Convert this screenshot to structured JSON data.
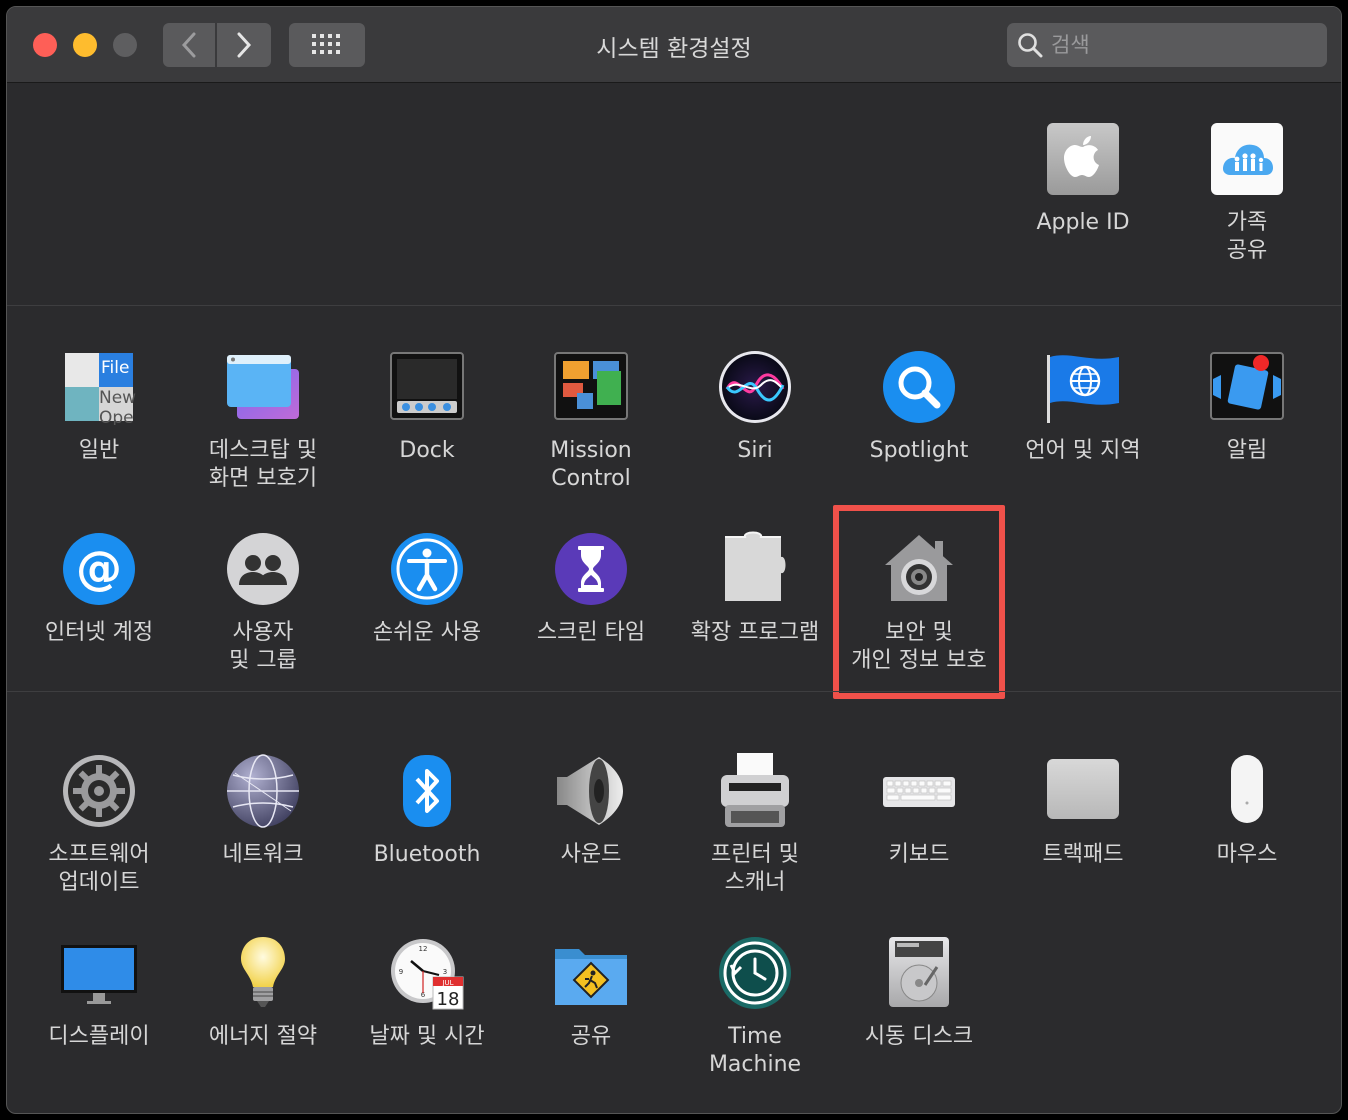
{
  "window": {
    "title": "시스템 환경설정",
    "search": {
      "placeholder": "검색",
      "value": ""
    }
  },
  "top_panes": [
    {
      "id": "apple-id",
      "label": "Apple ID",
      "icon": "apple-icon"
    },
    {
      "id": "family-sharing",
      "label": "가족\n공유",
      "icon": "family-icon"
    }
  ],
  "personal_panes": [
    {
      "id": "general",
      "label": "일반",
      "icon": "general-icon"
    },
    {
      "id": "desktop-screensaver",
      "label": "데스크탑 및\n화면 보호기",
      "icon": "desktop-icon"
    },
    {
      "id": "dock",
      "label": "Dock",
      "icon": "dock-icon"
    },
    {
      "id": "mission-control",
      "label": "Mission\nControl",
      "icon": "mission-control-icon"
    },
    {
      "id": "siri",
      "label": "Siri",
      "icon": "siri-icon"
    },
    {
      "id": "spotlight",
      "label": "Spotlight",
      "icon": "spotlight-icon"
    },
    {
      "id": "language-region",
      "label": "언어 및 지역",
      "icon": "flag-globe-icon"
    },
    {
      "id": "notifications",
      "label": "알림",
      "icon": "notifications-icon"
    },
    {
      "id": "internet-accounts",
      "label": "인터넷 계정",
      "icon": "at-icon"
    },
    {
      "id": "users-groups",
      "label": "사용자\n및 그룹",
      "icon": "users-icon"
    },
    {
      "id": "accessibility",
      "label": "손쉬운 사용",
      "icon": "accessibility-icon"
    },
    {
      "id": "screen-time",
      "label": "스크린 타임",
      "icon": "hourglass-icon"
    },
    {
      "id": "extensions",
      "label": "확장 프로그램",
      "icon": "puzzle-icon"
    },
    {
      "id": "security-privacy",
      "label": "보안 및\n개인 정보 보호",
      "icon": "security-house-icon"
    }
  ],
  "hardware_panes": [
    {
      "id": "software-update",
      "label": "소프트웨어\n업데이트",
      "icon": "gear-icon"
    },
    {
      "id": "network",
      "label": "네트워크",
      "icon": "network-globe-icon"
    },
    {
      "id": "bluetooth",
      "label": "Bluetooth",
      "icon": "bluetooth-icon"
    },
    {
      "id": "sound",
      "label": "사운드",
      "icon": "speaker-icon"
    },
    {
      "id": "printers-scanners",
      "label": "프린터 및\n스캐너",
      "icon": "printer-icon"
    },
    {
      "id": "keyboard",
      "label": "키보드",
      "icon": "keyboard-icon"
    },
    {
      "id": "trackpad",
      "label": "트랙패드",
      "icon": "trackpad-icon"
    },
    {
      "id": "mouse",
      "label": "마우스",
      "icon": "mouse-icon"
    },
    {
      "id": "displays",
      "label": "디스플레이",
      "icon": "display-icon"
    },
    {
      "id": "energy-saver",
      "label": "에너지 절약",
      "icon": "lightbulb-icon"
    },
    {
      "id": "date-time",
      "label": "날짜 및 시간",
      "icon": "clock-calendar-icon"
    },
    {
      "id": "sharing",
      "label": "공유",
      "icon": "sharing-folder-icon"
    },
    {
      "id": "time-machine",
      "label": "Time\nMachine",
      "icon": "time-machine-icon"
    },
    {
      "id": "startup-disk",
      "label": "시동 디스크",
      "icon": "hard-disk-icon"
    }
  ],
  "calendar_icon": {
    "month": "JUL",
    "day": "18"
  },
  "general_icon": {
    "text1": "File",
    "text2": "New",
    "text3": "Ope"
  },
  "highlighted_pane": "security-privacy",
  "colors": {
    "highlight": "#f0514a",
    "accent": "#0a84ff"
  }
}
